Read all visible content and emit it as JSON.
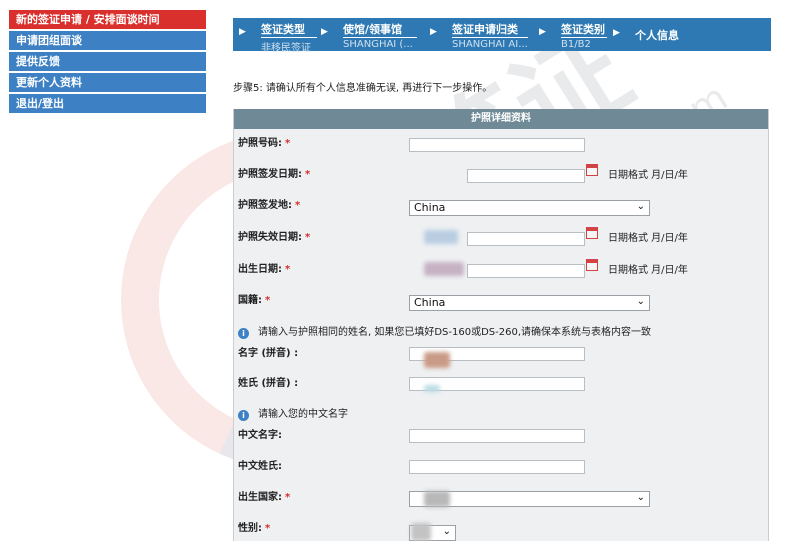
{
  "sidebar": {
    "items": [
      {
        "label": "新的签证申请 / 安排面谈时间",
        "active": true
      },
      {
        "label": "申请团组面谈",
        "active": false
      },
      {
        "label": "提供反馈",
        "active": false
      },
      {
        "label": "更新个人资料",
        "active": false
      },
      {
        "label": "退出/登出",
        "active": false
      }
    ]
  },
  "breadcrumb": {
    "steps": [
      {
        "title": "签证类型",
        "sub": "非移民签证"
      },
      {
        "title": "使馆/领事馆",
        "sub": "SHANGHAI (..."
      },
      {
        "title": "签证申请归类",
        "sub": "SHANGHAI AI..."
      },
      {
        "title": "签证类别",
        "sub": "B1/B2"
      },
      {
        "title": "个人信息",
        "sub": ""
      }
    ]
  },
  "step_text": "步骤5: 请确认所有个人信息准确无误, 再进行下一步操作。",
  "form": {
    "header": "护照详细资料",
    "required_mark": "*",
    "date_format": "日期格式 月/日/年",
    "fields": {
      "passport_number": "护照号码:",
      "issue_date": "护照签发日期:",
      "issue_place": "护照签发地:",
      "expiry_date": "护照失效日期:",
      "birth_date": "出生日期:",
      "nationality": "国籍:",
      "given_name": "名字 (拼音) :",
      "surname": "姓氏 (拼音) :",
      "chinese_given": "中文名字:",
      "chinese_surname": "中文姓氏:",
      "birth_country": "出生国家:",
      "gender": "性别:"
    },
    "values": {
      "issue_place": "China",
      "nationality": "China"
    },
    "info_name": "请输入与护照相同的姓名, 如果您已填好DS-160或DS-260,请确保本系统与表格内容一致",
    "info_chinese": "请输入您的中文名字"
  },
  "watermark": {
    "text": "签证",
    "site": "125visa.com"
  },
  "colors": {
    "sidebar": "#3d80c4",
    "sidebar_active": "#d9302e",
    "breadcrumb": "#2e79b3",
    "panel_header": "#6f8a96",
    "required": "#d62c2c"
  },
  "icons": {
    "crumb_arrow": "chevron-right-icon",
    "calendar": "calendar-icon",
    "info": "info-icon",
    "dropdown": "chevron-down-icon"
  }
}
